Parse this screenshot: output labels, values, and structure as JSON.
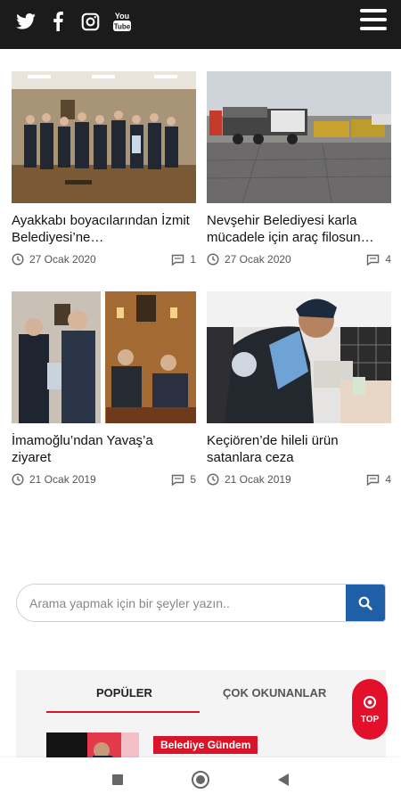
{
  "header": {
    "social": [
      {
        "icon": "twitter-icon"
      },
      {
        "icon": "facebook-icon"
      },
      {
        "icon": "instagram-icon"
      },
      {
        "icon": "youtube-icon",
        "text": "You Tube"
      }
    ],
    "menu_icon": "hamburger-menu-icon"
  },
  "articles": [
    {
      "title": "Ayakkabı boyacılarından İzmit Belediyesi’ne…",
      "date": "27 Ocak 2020",
      "comments": "1"
    },
    {
      "title": "Nevşehir Belediyesi karla mücadele için araç filosun…",
      "date": "27 Ocak 2020",
      "comments": "4"
    },
    {
      "title": "İmamoğlu’ndan Yavaş’a ziyaret",
      "date": "21 Ocak 2019",
      "comments": "5"
    },
    {
      "title": "Keçiören’de hileli ürün satanlara ceza",
      "date": "21 Ocak 2019",
      "comments": "4"
    }
  ],
  "search": {
    "placeholder": "Arama yapmak için bir şeyler yazın..",
    "value": ""
  },
  "tabs": {
    "popular": "POPÜLER",
    "most_read": "ÇOK OKUNANLAR"
  },
  "popular_item": {
    "badge": "Belediye Gündem"
  },
  "top_button": {
    "label": "TOP"
  },
  "colors": {
    "accent_red": "#d8152a",
    "search_blue": "#1f5fa8",
    "header_dark": "#1b1b1b"
  }
}
